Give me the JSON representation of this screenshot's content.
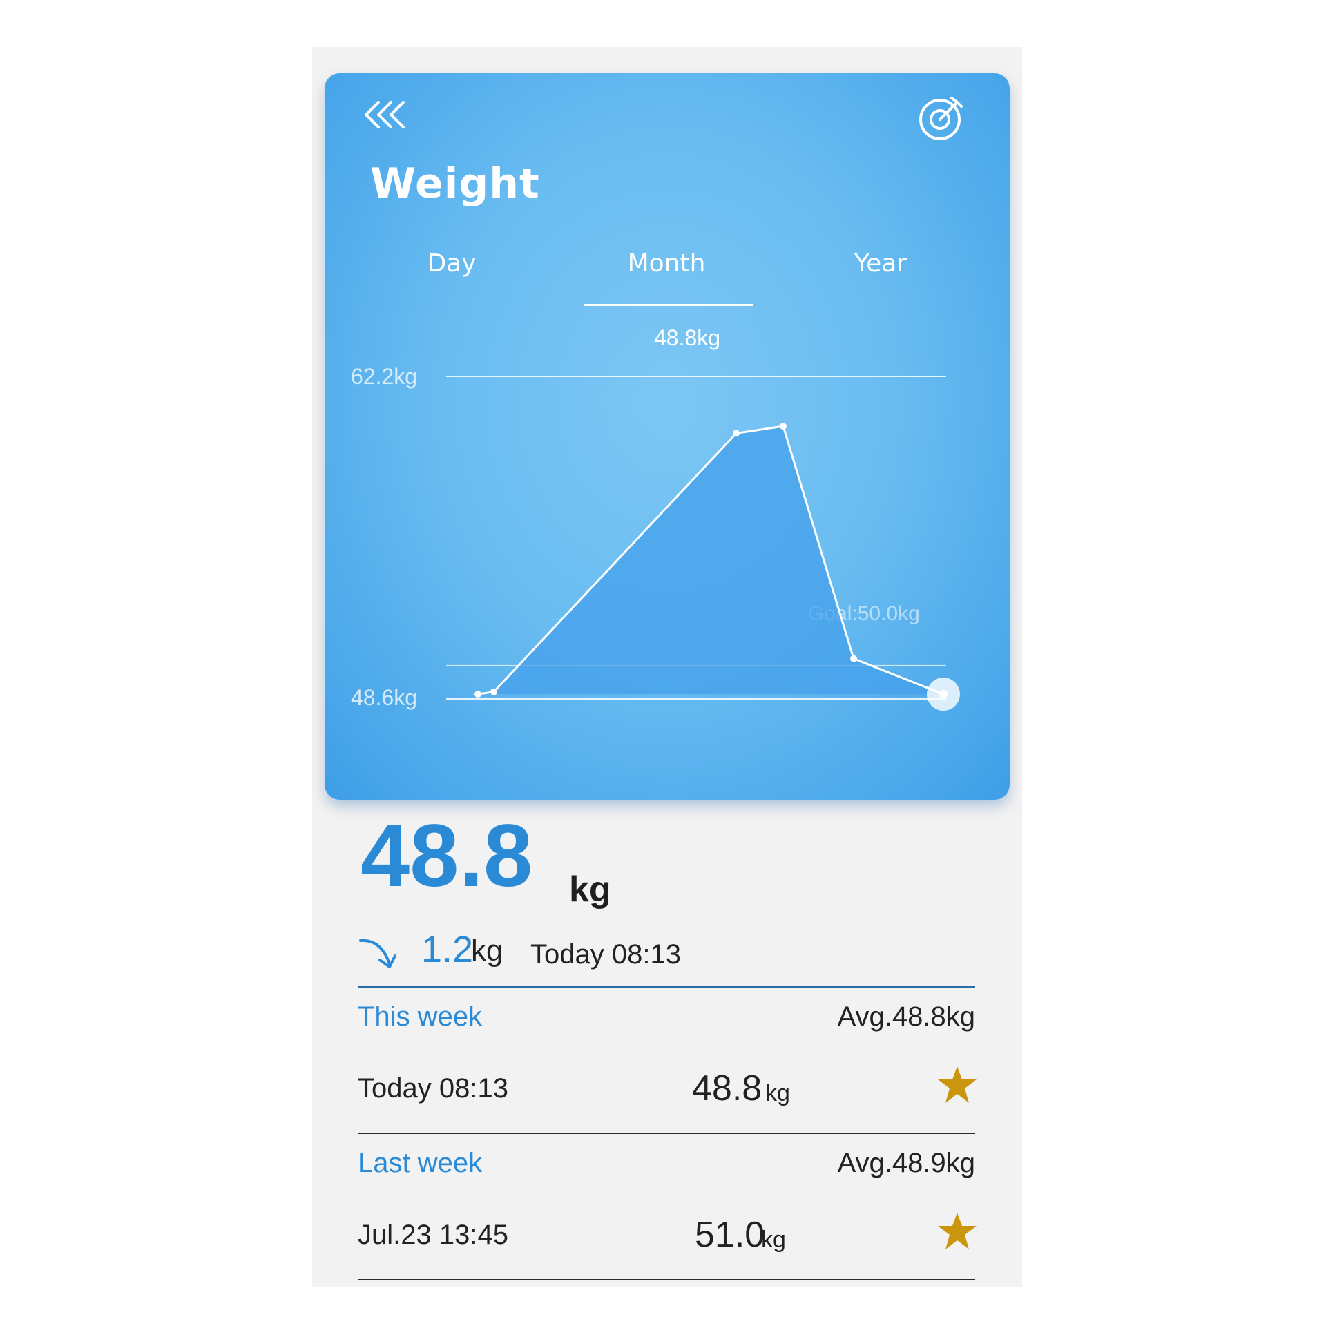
{
  "header": {
    "title": "Weight",
    "back_icon": "triple-chevron-left-icon",
    "goal_icon": "target-icon"
  },
  "tabs": [
    {
      "label": "Day",
      "selected": false
    },
    {
      "label": "Month",
      "selected": true
    },
    {
      "label": "Year",
      "selected": false
    }
  ],
  "chart": {
    "current_label": "48.8kg",
    "ymax_label": "62.2kg",
    "ymin_label": "48.6kg",
    "goal_label": "Goal:50.0kg"
  },
  "chart_data": {
    "type": "area",
    "ylim": [
      48.6,
      62.2
    ],
    "goal": 50.0,
    "values": [
      48.8,
      48.9,
      59.8,
      60.1,
      50.3,
      48.8
    ],
    "ymax_label": "62.2kg",
    "ymin_label": "48.6kg",
    "annotation": "Goal:50.0kg"
  },
  "summary": {
    "value": "48.8",
    "unit": "kg",
    "change_value": "1.2",
    "change_unit": "kg",
    "change_direction": "down",
    "time": "Today 08:13"
  },
  "sections": [
    {
      "title": "This week",
      "avg": "Avg.48.8kg",
      "records": [
        {
          "time": "Today 08:13",
          "value": "48.8",
          "unit": "kg",
          "icon": "star-icon"
        }
      ]
    },
    {
      "title": "Last week",
      "avg": "Avg.48.9kg",
      "records": [
        {
          "time": "Jul.23 13:45",
          "value": "51.0",
          "unit": "kg",
          "icon": "star-icon"
        }
      ]
    }
  ],
  "colors": {
    "accent": "#2a8ad6",
    "card": "#6abdf1",
    "star": "#c9960e"
  }
}
